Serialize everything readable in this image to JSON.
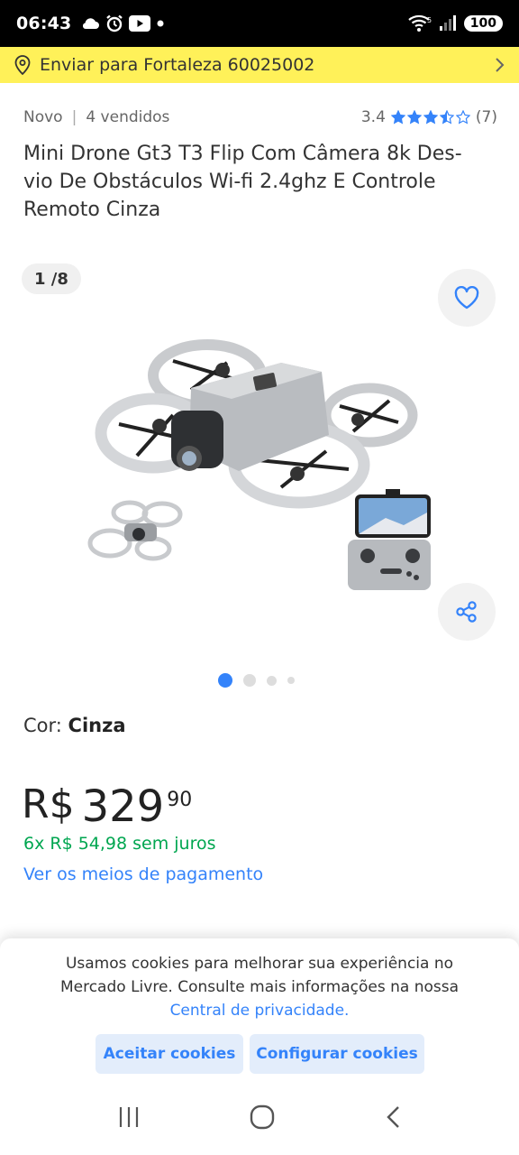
{
  "status": {
    "time": "06:43",
    "battery": "100"
  },
  "shipping": {
    "text": "Enviar para Fortaleza 60025002"
  },
  "product": {
    "condition": "Novo",
    "sold": "4 vendidos",
    "rating": "3.4",
    "rating_value": 3.4,
    "reviews": "(7)",
    "title_lines": [
      "Mini Drone Gt3 T3 Flip Com Câmera 8k Des-",
      "vio De Obstáculos Wi-fi 2.4ghz E Controle",
      "Remoto Cinza"
    ],
    "gallery_counter": "1 /8",
    "gallery_index": 1,
    "gallery_total": 8,
    "color_label": "Cor:",
    "color_value": "Cinza",
    "price_currency": "R$",
    "price_int": "329",
    "price_cents": "90",
    "installments": "6x R$ 54,98 sem juros",
    "payment_link": "Ver os meios de pagamento"
  },
  "cookie_banner": {
    "line1": "Usamos cookies para melhorar sua experiência no",
    "line2": "Mercado Livre. Consulte mais informações na nossa",
    "link": "Central de privacidade.",
    "accept": "Aceitar cookies",
    "configure": "Configurar cookies"
  },
  "icons": {
    "location": "location-pin-icon",
    "chevron": "chevron-right-icon",
    "heart": "heart-icon",
    "share": "share-icon"
  },
  "colors": {
    "yellow": "#fff159",
    "blue": "#3483fa",
    "green": "#00a650",
    "black": "#000000"
  }
}
